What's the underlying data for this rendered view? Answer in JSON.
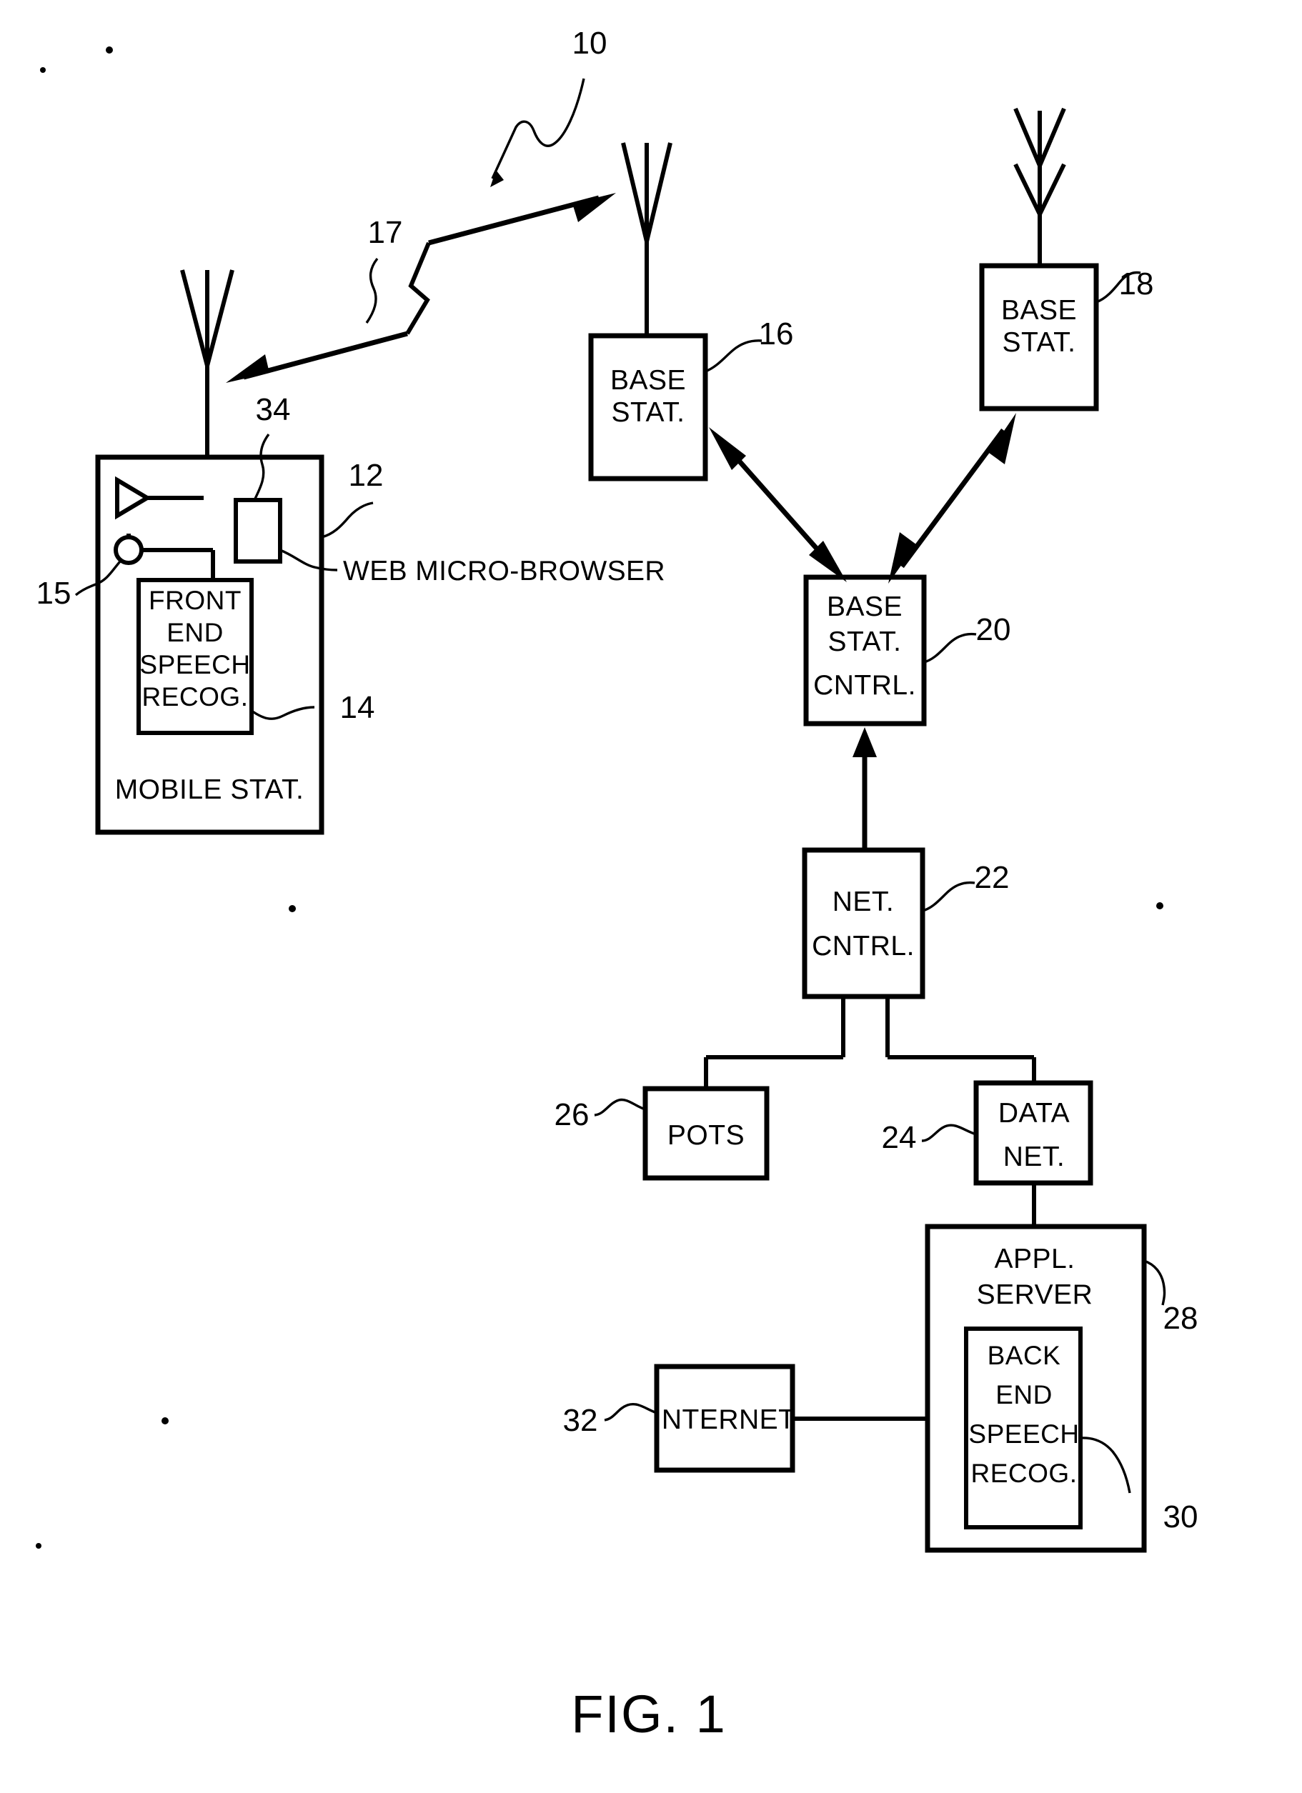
{
  "figure": {
    "title": "FIG. 1",
    "system_ref": "10"
  },
  "nodes": {
    "mobile_station": {
      "label": "MOBILE STAT.",
      "ref": "12",
      "front_end": {
        "lines": [
          "FRONT",
          "END",
          "SPEECH",
          "RECOG."
        ],
        "ref": "14"
      },
      "micro_browser": {
        "ref": "34",
        "callout": "WEB MICRO-BROWSER"
      },
      "microphone_ref": "15"
    },
    "radio_link": {
      "ref": "17"
    },
    "base_station_16": {
      "lines": [
        "BASE",
        "STAT."
      ],
      "ref": "16"
    },
    "base_station_18": {
      "lines": [
        "BASE",
        "STAT."
      ],
      "ref": "18"
    },
    "base_station_controller": {
      "lines": [
        "BASE",
        "STAT.",
        "CNTRL."
      ],
      "ref": "20"
    },
    "network_controller": {
      "lines": [
        "NET.",
        "CNTRL."
      ],
      "ref": "22"
    },
    "pots": {
      "lines": [
        "POTS"
      ],
      "ref": "26"
    },
    "data_net": {
      "lines": [
        "DATA",
        "NET."
      ],
      "ref": "24"
    },
    "appl_server": {
      "lines": [
        "APPL.",
        "SERVER"
      ],
      "ref": "28",
      "back_end": {
        "lines": [
          "BACK",
          "END",
          "SPEECH",
          "RECOG."
        ],
        "ref": "30"
      }
    },
    "internet": {
      "lines": [
        "INTERNET"
      ],
      "ref": "32"
    }
  },
  "colors": {
    "ink": "#000000",
    "paper": "#ffffff"
  }
}
